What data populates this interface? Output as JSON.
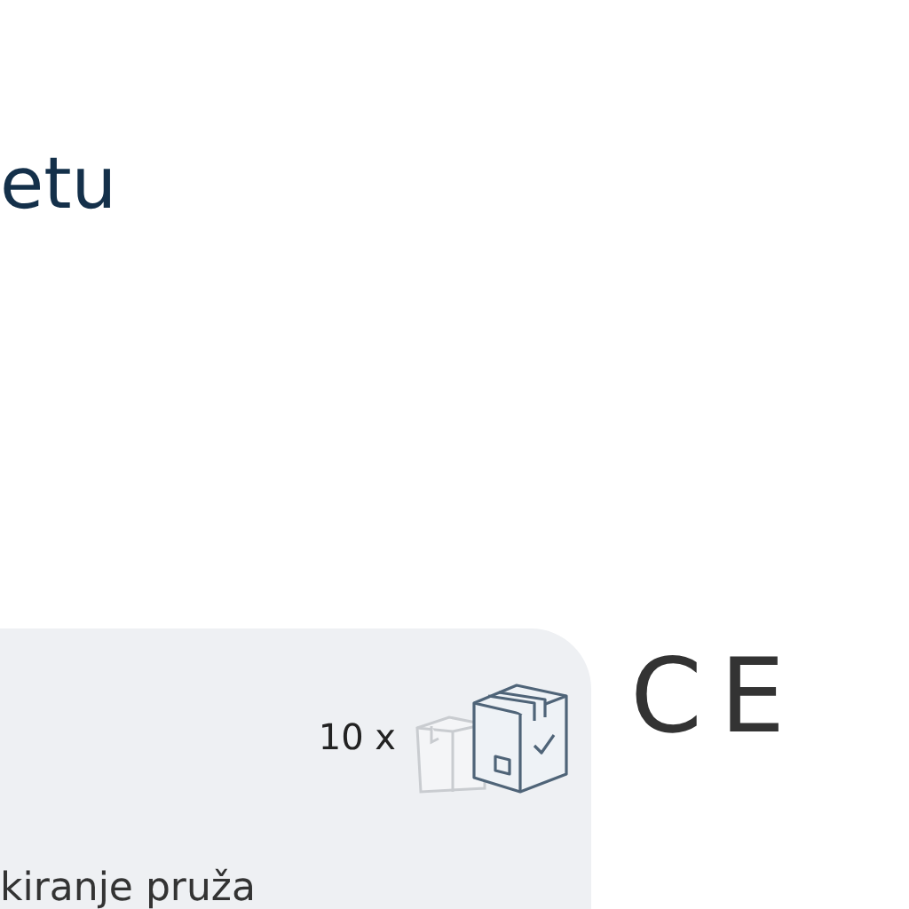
{
  "heading": "etu",
  "card": {
    "quantity": "10 x",
    "text": "kiranje pruža"
  },
  "certification": "CE"
}
